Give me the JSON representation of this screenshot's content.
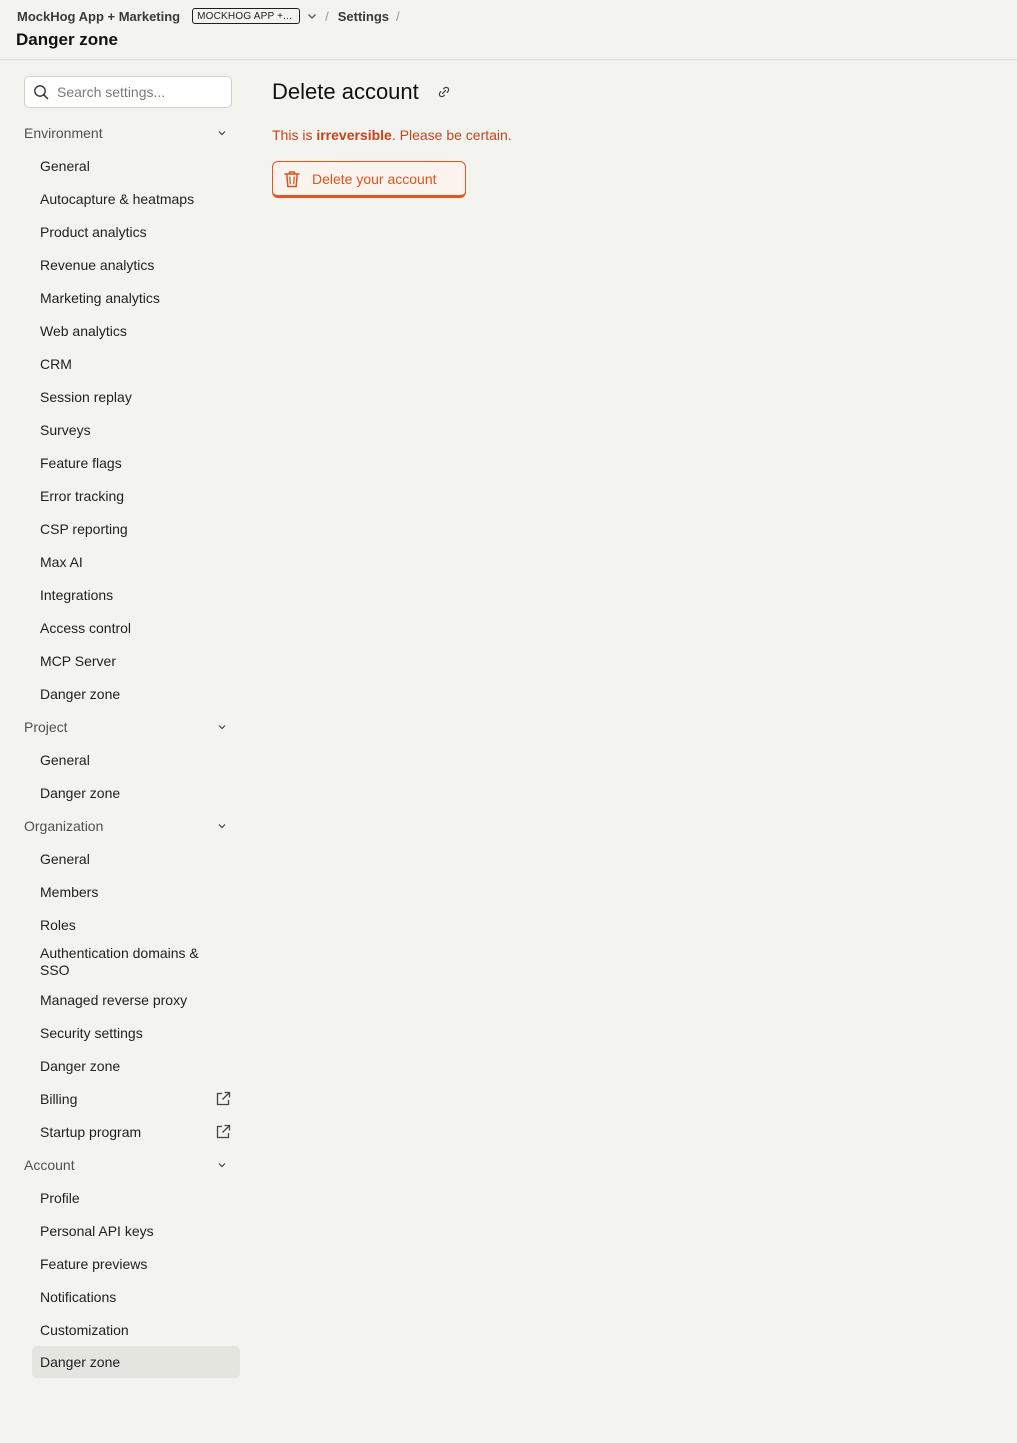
{
  "header": {
    "org_name": "MockHog App + Marketing",
    "env_badge": "MOCKHOG APP +...",
    "crumb_settings": "Settings",
    "separator": "/",
    "page_title": "Danger zone"
  },
  "search": {
    "placeholder": "Search settings..."
  },
  "sidebar": {
    "sections": [
      {
        "label": "Environment",
        "items": [
          "General",
          "Autocapture & heatmaps",
          "Product analytics",
          "Revenue analytics",
          "Marketing analytics",
          "Web analytics",
          "CRM",
          "Session replay",
          "Surveys",
          "Feature flags",
          "Error tracking",
          "CSP reporting",
          "Max AI",
          "Integrations",
          "Access control",
          "MCP Server",
          "Danger zone"
        ]
      },
      {
        "label": "Project",
        "items": [
          "General",
          "Danger zone"
        ]
      },
      {
        "label": "Organization",
        "items": [
          "General",
          "Members",
          "Roles",
          "Authentication domains & SSO",
          "Managed reverse proxy",
          "Security settings",
          "Danger zone",
          "Billing",
          "Startup program"
        ]
      },
      {
        "label": "Account",
        "items": [
          "Profile",
          "Personal API keys",
          "Feature previews",
          "Notifications",
          "Customization",
          "Danger zone"
        ]
      }
    ],
    "external_items": [
      "Billing",
      "Startup program"
    ],
    "active": {
      "section": "Account",
      "item": "Danger zone"
    }
  },
  "main": {
    "heading": "Delete account",
    "warning_prefix": "This is ",
    "warning_bold": "irreversible",
    "warning_suffix": ". Please be certain.",
    "delete_button": "Delete your account"
  },
  "colors": {
    "danger": "#e5551f",
    "danger_text": "#c6441b",
    "background": "#f3f3ef",
    "active_item": "#e5e5e0"
  },
  "icons": [
    "search-icon",
    "chevron-down-icon",
    "link-icon",
    "trash-icon",
    "external-link-icon"
  ]
}
